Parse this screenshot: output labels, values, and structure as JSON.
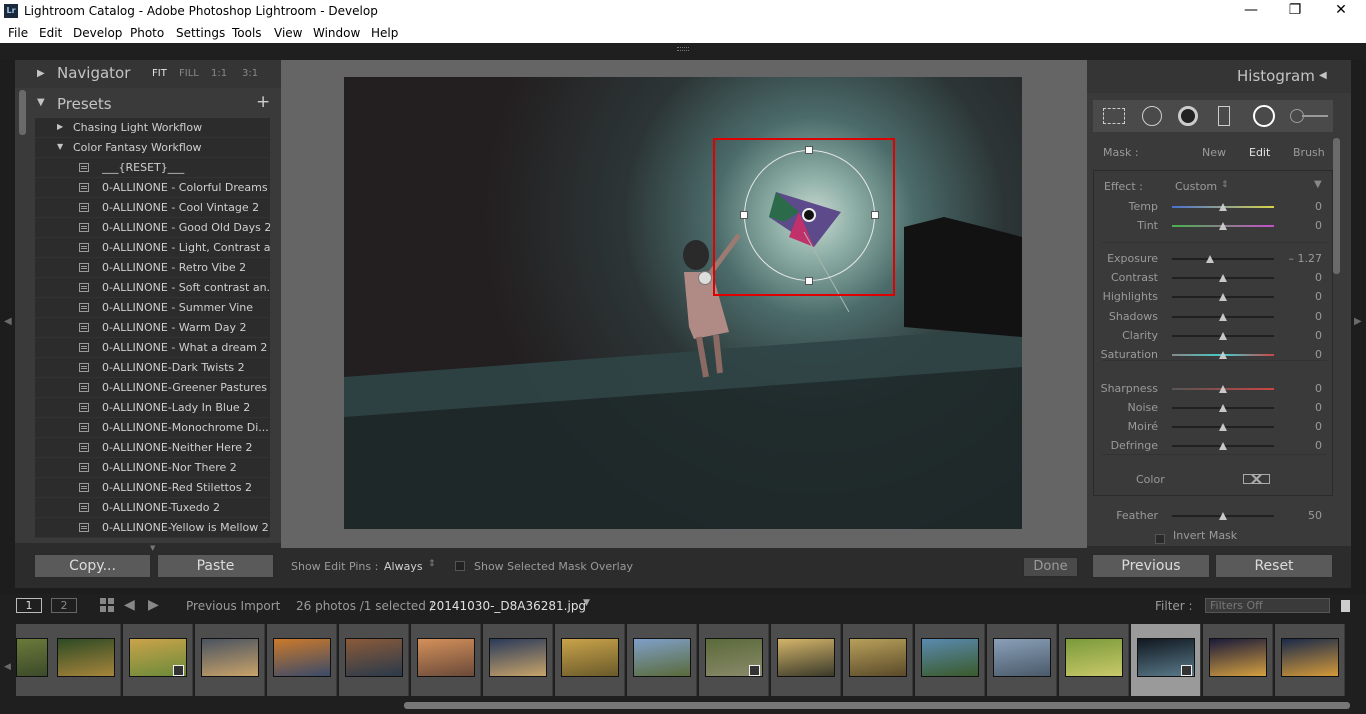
{
  "window": {
    "title": "Lightroom Catalog - Adobe Photoshop Lightroom - Develop",
    "app_badge": "Lr",
    "minimize": "—",
    "restore": "❐",
    "close": "✕"
  },
  "menu": [
    "File",
    "Edit",
    "Develop",
    "Photo",
    "Settings",
    "Tools",
    "View",
    "Window",
    "Help"
  ],
  "navigator": {
    "title": "Navigator",
    "zoom_options": [
      "FIT",
      "FILL",
      "1:1",
      "3:1"
    ]
  },
  "presets": {
    "title": "Presets",
    "add": "+",
    "folders": [
      {
        "label": "Chasing Light Workflow",
        "expanded": false
      },
      {
        "label": "Color Fantasy Workflow",
        "expanded": true
      }
    ],
    "items": [
      "___{RESET}___",
      "0-ALLINONE - Colorful Dreams 2",
      "0-ALLINONE - Cool Vintage 2",
      "0-ALLINONE - Good Old Days 2",
      "0-ALLINONE - Light, Contrast a...",
      "0-ALLINONE - Retro Vibe 2",
      "0-ALLINONE - Soft contrast an...",
      "0-ALLINONE - Summer Vine",
      "0-ALLINONE - Warm Day 2",
      "0-ALLINONE - What a dream 2",
      "0-ALLINONE-Dark Twists 2",
      "0-ALLINONE-Greener Pastures 2",
      "0-ALLINONE-Lady In Blue 2",
      "0-ALLINONE-Monochrome Di...",
      "0-ALLINONE-Neither Here 2",
      "0-ALLINONE-Nor There 2",
      "0-ALLINONE-Red Stilettos 2",
      "0-ALLINONE-Tuxedo 2",
      "0-ALLINONE-Yellow is Mellow 2"
    ]
  },
  "left_buttons": {
    "copy": "Copy...",
    "paste": "Paste"
  },
  "toolbar": {
    "edit_pins_label": "Show Edit Pins :",
    "edit_pins_value": "Always",
    "mask_overlay": "Show Selected Mask Overlay",
    "done": "Done"
  },
  "histogram": {
    "title": "Histogram"
  },
  "mask": {
    "label": "Mask :",
    "new": "New",
    "edit": "Edit",
    "brush": "Brush"
  },
  "effect": {
    "label": "Effect :",
    "value": "Custom"
  },
  "sliders": [
    {
      "name": "Temp",
      "value": "0",
      "pos": 0.5,
      "tint": "linear-gradient(90deg,#4a6fd1,#d8d34a)"
    },
    {
      "name": "Tint",
      "value": "0",
      "pos": 0.5,
      "tint": "linear-gradient(90deg,#49b24c,#c64fc9)"
    },
    {
      "name": "Exposure",
      "value": "– 1.27",
      "pos": 0.37
    },
    {
      "name": "Contrast",
      "value": "0",
      "pos": 0.5
    },
    {
      "name": "Highlights",
      "value": "0",
      "pos": 0.5
    },
    {
      "name": "Shadows",
      "value": "0",
      "pos": 0.5
    },
    {
      "name": "Clarity",
      "value": "0",
      "pos": 0.5
    },
    {
      "name": "Saturation",
      "value": "0",
      "pos": 0.5,
      "tint": "linear-gradient(90deg,#888,#4cc,#c44)"
    },
    {
      "name": "Sharpness",
      "value": "0",
      "pos": 0.5,
      "tint": "linear-gradient(90deg,#555,#c44)"
    },
    {
      "name": "Noise",
      "value": "0",
      "pos": 0.5
    },
    {
      "name": "Moiré",
      "value": "0",
      "pos": 0.5
    },
    {
      "name": "Defringe",
      "value": "0",
      "pos": 0.5
    }
  ],
  "color_label": "Color",
  "feather": {
    "name": "Feather",
    "value": "50",
    "pos": 0.5
  },
  "invert_mask": "Invert Mask",
  "right_buttons": {
    "previous": "Previous",
    "reset": "Reset"
  },
  "filmbar": {
    "view1": "1",
    "view2": "2",
    "source": "Previous Import",
    "count": "26 photos /1 selected /",
    "filename": "20141030-_D8A36281.jpg",
    "filter_label": "Filter :",
    "filter_value": "Filters Off"
  },
  "thumb_colors": [
    [
      "#6a7a3a",
      "#3d4a2a"
    ],
    [
      "#2e4a24",
      "#a7853c"
    ],
    [
      "#caa34a",
      "#6b8a3a"
    ],
    [
      "#4a5360",
      "#c9a36a"
    ],
    [
      "#cc7a2a",
      "#3a4a6a"
    ],
    [
      "#8a5a3a",
      "#2a3a4a"
    ],
    [
      "#d4905a",
      "#6a4a3a"
    ],
    [
      "#2a3a5a",
      "#c8a46a"
    ],
    [
      "#c9a34a",
      "#6a5a2a"
    ],
    [
      "#7fa0c9",
      "#5a6a3a"
    ],
    [
      "#5a6a3a",
      "#8a8a6a"
    ],
    [
      "#d4b46a",
      "#3a3a2a"
    ],
    [
      "#b8a05a",
      "#5a4a2a"
    ],
    [
      "#5a8ab0",
      "#3a5a2a"
    ],
    [
      "#8aa0b8",
      "#4a5a6a"
    ],
    [
      "#7a9a3a",
      "#c9c96a"
    ],
    [
      "#101820",
      "#5a7a8a"
    ],
    [
      "#1a1a3a",
      "#d4a040"
    ],
    [
      "#1a2a4a",
      "#d49a3a"
    ]
  ]
}
